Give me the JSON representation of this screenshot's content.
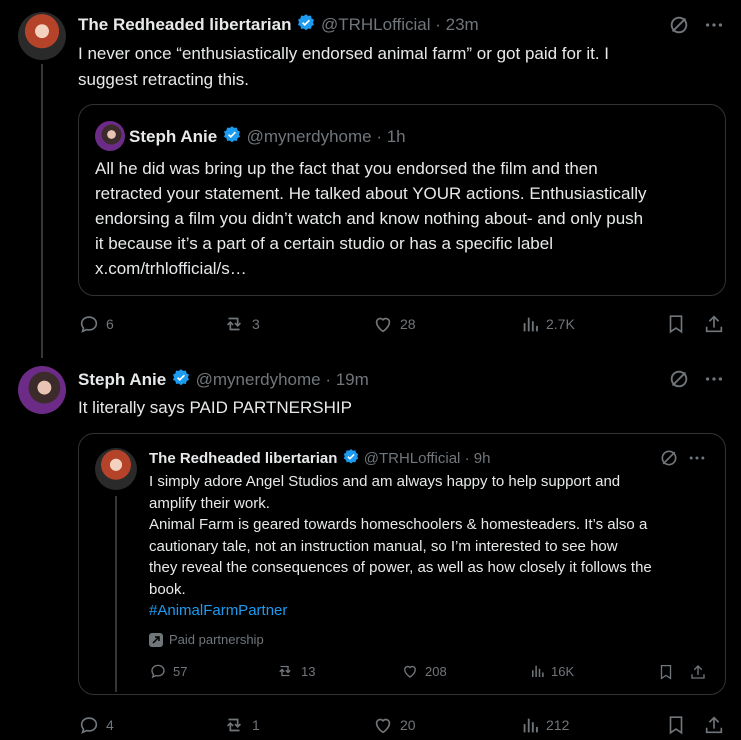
{
  "tweet1": {
    "name": "The Redheaded libertarian",
    "handle": "@TRHLofficial",
    "time": "· 23m",
    "text_line1": "I never once “enthusiastically endorsed animal farm” or got paid for it. I",
    "text_line2": "suggest retracting this.",
    "quote": {
      "name": "Steph Anie",
      "handle": "@mynerdyhome",
      "time": "· 1h",
      "lines": [
        "All he did was bring up the fact that you endorsed the film and then",
        "retracted your statement. He talked about YOUR actions. Enthusiastically",
        "endorsing a film you didn’t watch and know nothing about- and only push",
        "it because it’s a part of a certain studio or has a specific label",
        "x.com/trhlofficial/s…"
      ]
    },
    "stats": {
      "replies": "6",
      "reposts": "3",
      "likes": "28",
      "views": "2.7K"
    }
  },
  "tweet2": {
    "name": "Steph Anie",
    "handle": "@mynerdyhome",
    "time": "· 19m",
    "text": "It literally says PAID PARTNERSHIP",
    "quote": {
      "name": "The Redheaded libertarian",
      "handle": "@TRHLofficial",
      "time": "· 9h",
      "lines": [
        "I simply adore Angel Studios and am always happy to help support and",
        "amplify their work.",
        "Animal Farm is geared towards homeschoolers & homesteaders. It’s also a",
        "cautionary tale, not an instruction manual, so I’m interested to see how",
        "they reveal the consequences of power, as well as how closely it follows the",
        "book."
      ],
      "hashtag": "#AnimalFarmPartner",
      "paid_label": "Paid partnership",
      "stats": {
        "replies": "57",
        "reposts": "13",
        "likes": "208",
        "views": "16K"
      }
    },
    "stats": {
      "replies": "4",
      "reposts": "1",
      "likes": "20",
      "views": "212"
    }
  },
  "colors": {
    "background": "#000000",
    "text": "#e7e9ea",
    "muted": "#71767b",
    "accent": "#1d9bf0",
    "border": "#2f3336"
  }
}
